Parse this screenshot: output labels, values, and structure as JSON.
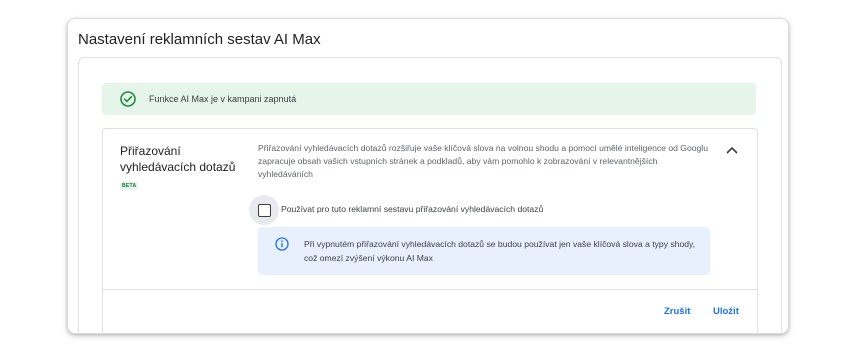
{
  "dialog": {
    "title": "Nastavení reklamních sestav AI Max"
  },
  "banner": {
    "text": "Funkce AI Max je v kampani zapnutá",
    "icon": "check-circle-icon",
    "color": "#1e8e3e"
  },
  "section": {
    "title": "Přiřazování vyhledávacích dotazů",
    "badge": "BETA",
    "description": "Přiřazování vyhledávacích dotazů rozšiřuje vaše klíčová slova na volnou shodu a pomocí umělé inteligence od Googlu zapracuje obsah vašich vstupních stránek a podkladů, aby vám pomohlo k zobrazování v relevantnějších vyhledáváních",
    "checkbox_label": "Používat pro tuto reklamní sestavu přiřazování vyhledávacích dotazů",
    "checkbox_checked": false,
    "info_text": "Při vypnutém přiřazování vyhledávacích dotazů se budou používat jen vaše klíčová slova a typy shody, což omezí zvýšení výkonu AI Max"
  },
  "actions": {
    "cancel_label": "Zrušit",
    "save_label": "Uložit"
  },
  "colors": {
    "accent": "#1a73e8",
    "success_bg": "#e6f4ea",
    "info_bg": "#e8f0fe"
  }
}
